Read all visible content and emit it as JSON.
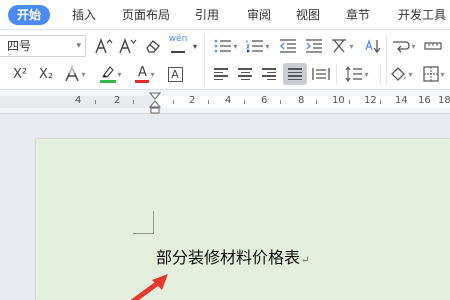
{
  "menu": {
    "tabs": [
      {
        "label": "开始",
        "active": true
      },
      {
        "label": "插入"
      },
      {
        "label": "页面布局"
      },
      {
        "label": "引用"
      },
      {
        "label": "审阅"
      },
      {
        "label": "视图"
      },
      {
        "label": "章节"
      },
      {
        "label": "开发工具"
      }
    ]
  },
  "toolbar": {
    "font_size_value": "四号",
    "wen_label": "wén",
    "text_format_letter": "A",
    "superscript_label": "X²",
    "subscript_label": "X₂",
    "dropdown_caret": "▾",
    "highlight_color": "#2ebd4a",
    "font_color": "#e02b2b"
  },
  "ruler": {
    "numbers": [
      "4",
      "2",
      "2",
      "4",
      "6",
      "8",
      "10",
      "12",
      "14",
      "16",
      "18"
    ]
  },
  "document": {
    "text": "部分装修材料价格表",
    "paragraph_mark": "↵",
    "page_color": "#e3efdc"
  },
  "annotation": {
    "arrow_color": "#e8382e"
  }
}
